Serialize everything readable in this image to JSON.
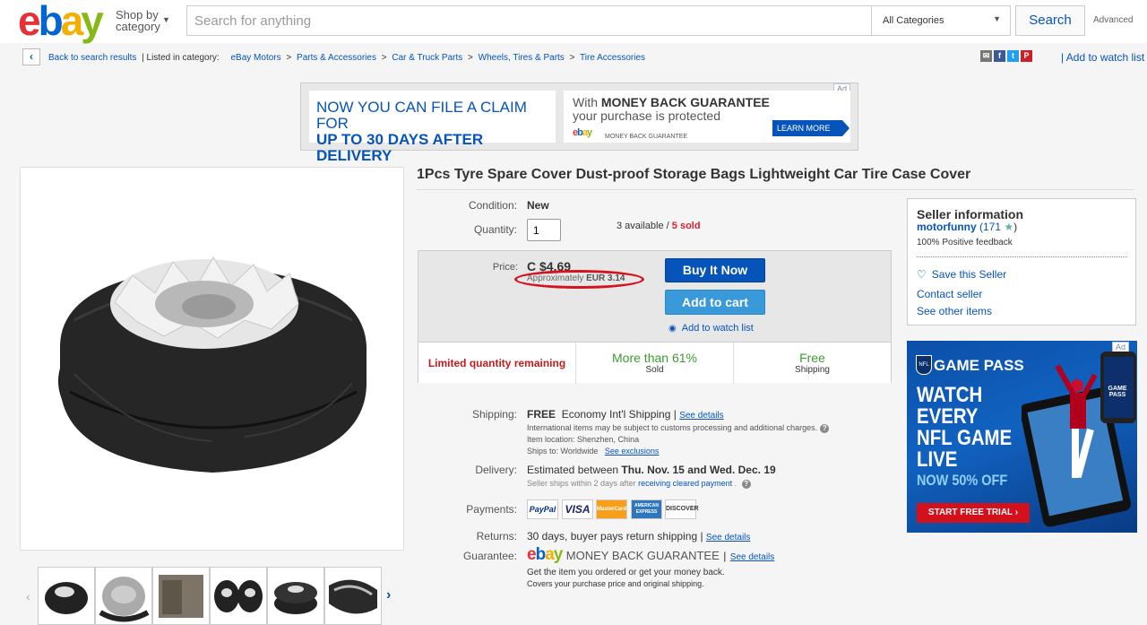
{
  "header": {
    "logo_letters": [
      "e",
      "b",
      "a",
      "y"
    ],
    "logo_colors": [
      "#e53238",
      "#0064d2",
      "#f5af02",
      "#86b817"
    ],
    "shop_by": "Shop by",
    "category": "category",
    "search_placeholder": "Search for anything",
    "category_select": "All Categories",
    "search_button": "Search",
    "advanced": "Advanced"
  },
  "breadcrumb": {
    "back": "Back to search results",
    "listed_in": "| Listed in category:",
    "items": [
      "eBay Motors",
      ">",
      "Parts & Accessories",
      ">",
      "Car & Truck Parts",
      ">",
      "Wheels, Tires & Parts",
      ">",
      "Tire Accessories"
    ]
  },
  "share": {
    "icons": [
      "email-icon",
      "facebook-icon",
      "twitter-icon",
      "pinterest-icon"
    ],
    "icon_glyphs": [
      "✉",
      "f",
      "t",
      "P"
    ],
    "icon_colors": [
      "#777",
      "#3b5998",
      "#1da1f2",
      "#cb2027"
    ],
    "watch_link": "| Add to watch list"
  },
  "ad_banner": {
    "ad_tag": "Ad",
    "claim_line1": "NOW YOU CAN FILE A CLAIM FOR",
    "claim_line2": "UP TO 30 DAYS AFTER  DELIVERY",
    "mbg_line1_pre": "With ",
    "mbg_line1_bold": "MONEY BACK GUARANTEE",
    "mbg_line2": "your purchase is protected",
    "mbg_logo": "ebay",
    "mbg_tag": "MONEY BACK GUARANTEE",
    "learn_more": "LEARN MORE"
  },
  "product": {
    "title": "1Pcs Tyre Spare Cover Dust-proof Storage Bags Lightweight Car Tire Case Cover",
    "condition_label": "Condition:",
    "condition": "New",
    "quantity_label": "Quantity:",
    "quantity_value": "1",
    "available": "3 available /",
    "sold": "5 sold",
    "price_label": "Price:",
    "price": "C $4.69",
    "approx_pre": "Approximately",
    "approx_val": "EUR 3.14",
    "buy_now": "Buy It Now",
    "add_to_cart": "Add to cart",
    "watch": "Add to watch list",
    "stats": [
      {
        "main": "Limited quantity remaining",
        "sub": ""
      },
      {
        "main": "More than 61%",
        "sub": "Sold"
      },
      {
        "main": "Free",
        "sub": "Shipping"
      }
    ]
  },
  "shipping": {
    "label": "Shipping:",
    "free": "FREE",
    "method": "Economy Int'l Shipping |",
    "see_details": "See details",
    "line1": "International items may be subject to customs processing and additional charges.",
    "line2": "Item location:  Shenzhen, China",
    "line3_pre": "Ships to:  Worldwide",
    "see_exclusions": "See exclusions",
    "delivery_label": "Delivery:",
    "delivery_pre": "Estimated between",
    "delivery_dates": "Thu. Nov. 15 and Wed. Dec. 19",
    "delivery_sub_pre": "Seller ships within 2 days after",
    "delivery_sub_link": "receiving cleared payment",
    "payments_label": "Payments:",
    "payment_methods": [
      "PayPal",
      "VISA",
      "MasterCard",
      "AMERICAN EXPRESS",
      "DISCOVER"
    ],
    "returns_label": "Returns:",
    "returns": "30 days, buyer pays return shipping |",
    "returns_link": "See details",
    "guarantee_label": "Guarantee:",
    "guarantee_logo": "ebay",
    "guarantee_text": "MONEY BACK GUARANTEE",
    "guarantee_link": "See details",
    "guarantee_l1": "Get the item you ordered or get your money back.",
    "guarantee_l2": "Covers your purchase price and original shipping."
  },
  "seller": {
    "heading": "Seller information",
    "name": "motorfunny",
    "score": "(171",
    "score_end": ")",
    "feedback": "100% Positive feedback",
    "save": "Save this Seller",
    "contact": "Contact seller",
    "other": "See other items"
  },
  "nfl_ad": {
    "ad_tag": "Ad",
    "shield": "NFL",
    "head": "GAME PASS",
    "lines": [
      "WATCH",
      "EVERY",
      "NFL GAME",
      "LIVE"
    ],
    "offer": "NOW 50% OFF",
    "cta": "START FREE TRIAL ›",
    "tablet_text": "GAME PASS"
  },
  "nav": {
    "prev": "‹",
    "next": "›"
  }
}
